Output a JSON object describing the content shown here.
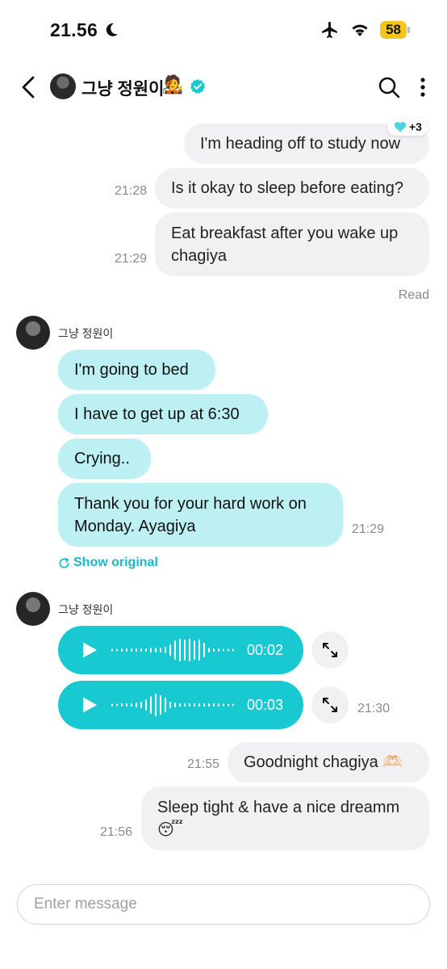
{
  "status_bar": {
    "time": "21.56",
    "battery": "58"
  },
  "header": {
    "contact_name": "그냥 정원이",
    "name_emoji": "🧑‍🎤"
  },
  "messages": {
    "m1": {
      "text": "I'm heading off to study now",
      "reaction_count": "+3"
    },
    "m2": {
      "text": "Is it okay to sleep before eating?",
      "time": "21:28"
    },
    "m3": {
      "text": "Eat breakfast after you wake up chagiya",
      "time": "21:29"
    },
    "read_label": "Read",
    "group1": {
      "sender": "그냥 정원이",
      "b1": "I'm going to bed",
      "b2": "I have to get up at 6:30",
      "b3": "Crying..",
      "b4": "Thank you for your hard work on Monday. Ayagiya",
      "time": "21:29",
      "show_original": "Show original"
    },
    "group2": {
      "sender": "그냥 정원이",
      "voice1_duration": "00:02",
      "voice2_duration": "00:03",
      "time": "21:30"
    },
    "m4": {
      "text": "Goodnight chagiya 🫶🏻",
      "time": "21:55"
    },
    "m5": {
      "text": "Sleep tight & have a nice dreamm 😴",
      "time": "21:56"
    }
  },
  "composer": {
    "placeholder": "Enter message"
  },
  "colors": {
    "accent": "#19c9d2",
    "their_bubble": "#bdf0f3",
    "my_bubble": "#f1f1f4",
    "battery": "#f5c518"
  }
}
